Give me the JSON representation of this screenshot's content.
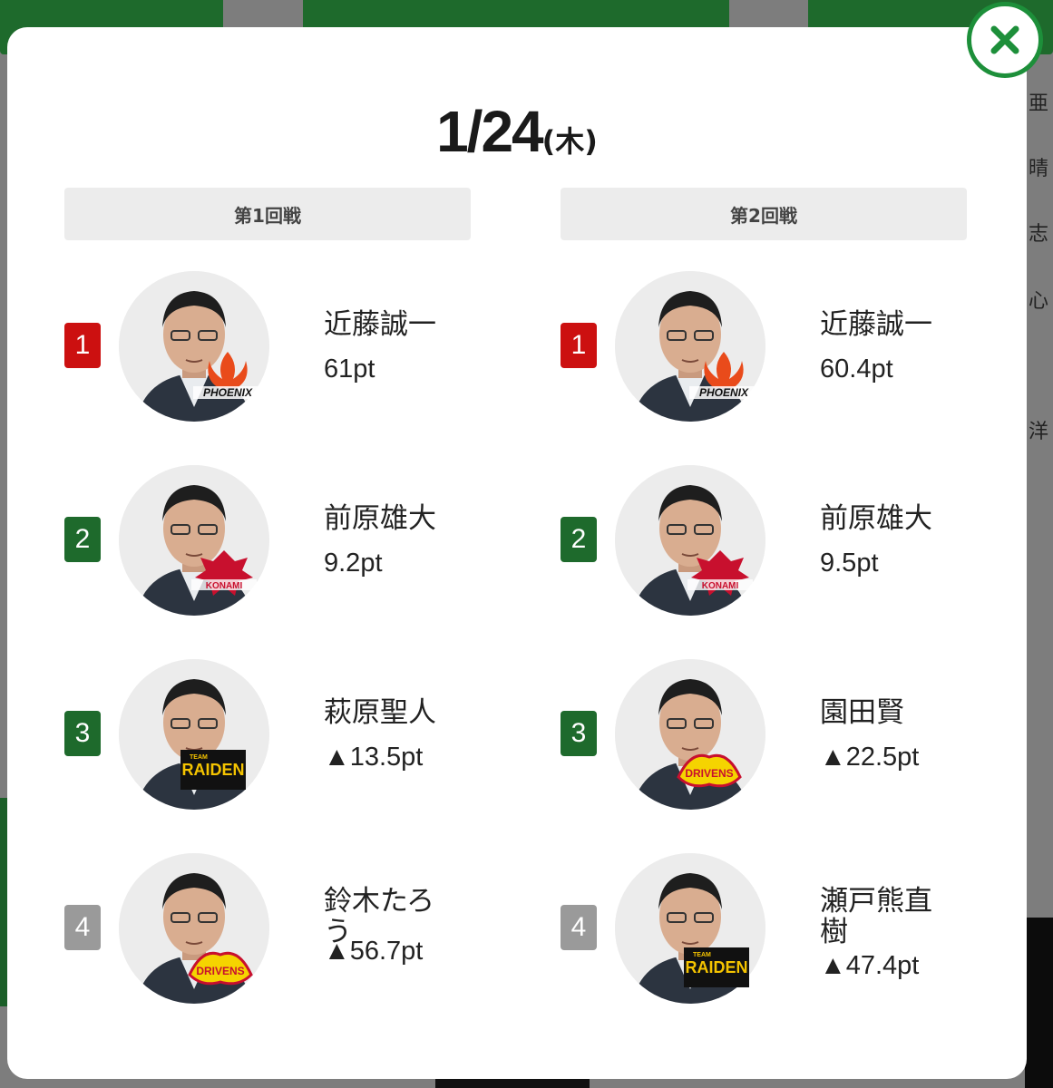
{
  "modal": {
    "date": "1/24",
    "weekday": "(木)",
    "close_icon": "close-icon",
    "accent": "#1d8f3a"
  },
  "rank_colors": {
    "1": "#cc1010",
    "2": "#1e6a2c",
    "3": "#1e6a2c",
    "4": "#9a9a9a"
  },
  "games": [
    {
      "title": "第1回戦",
      "players": [
        {
          "rank": "1",
          "name": "近藤誠一",
          "score": "61pt",
          "team_logo": "phoenix-logo"
        },
        {
          "rank": "2",
          "name": "前原雄大",
          "score": "9.2pt",
          "team_logo": "konami-logo"
        },
        {
          "rank": "3",
          "name": "萩原聖人",
          "score": "▲13.5pt",
          "team_logo": "raiden-logo"
        },
        {
          "rank": "4",
          "name": "鈴木たろう",
          "score": "▲56.7pt",
          "team_logo": "drivens-logo"
        }
      ]
    },
    {
      "title": "第2回戦",
      "players": [
        {
          "rank": "1",
          "name": "近藤誠一",
          "score": "60.4pt",
          "team_logo": "phoenix-logo"
        },
        {
          "rank": "2",
          "name": "前原雄大",
          "score": "9.5pt",
          "team_logo": "konami-logo"
        },
        {
          "rank": "3",
          "name": "園田賢",
          "score": "▲22.5pt",
          "team_logo": "drivens-logo"
        },
        {
          "rank": "4",
          "name": "瀬戸熊直樹",
          "score": "▲47.4pt",
          "team_logo": "raiden-logo"
        }
      ]
    }
  ],
  "background": {
    "side_chars": [
      "亜",
      "晴",
      "志",
      "心",
      "洋"
    ]
  }
}
